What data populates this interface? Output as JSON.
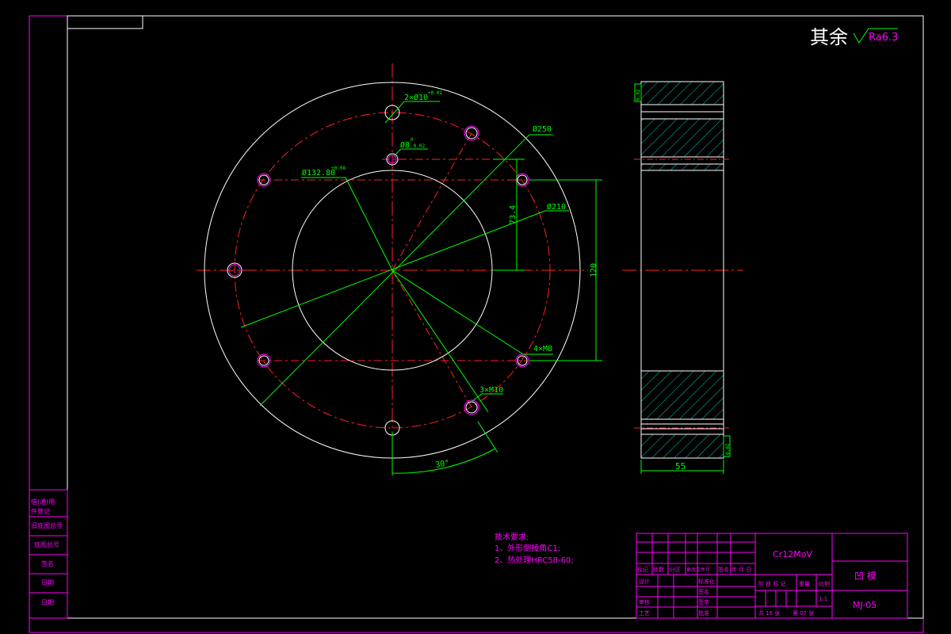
{
  "roughness": {
    "prefix": "其余",
    "value": "Ra6.3"
  },
  "dims": {
    "holes_top": "2×Ø10",
    "holes_top_tol": "+0.01",
    "d250": "Ø250",
    "d8": "Ø8",
    "d8_tol_up": "0",
    "d8_tol_low": "-0.02",
    "d13280": "Ø132.80",
    "d13280_tol": "+0.08",
    "d210": "Ø210",
    "v734": "73.4",
    "v120": "120",
    "m8": "4×M8",
    "m10": "3×M10",
    "angle": "30°",
    "width": "55",
    "tol_side_top": "0.02",
    "tol_side_bot": "0.02"
  },
  "tech": {
    "title": "技术要求:",
    "line1": "1、外形倒棱角C1;",
    "line2": "2、热处理HRC58-60;"
  },
  "left_labels": [
    "借(通)用",
    "件登记",
    "旧底图总号",
    "底图总号",
    "签名",
    "日期",
    "日期"
  ],
  "title_block": {
    "material": "Cr12MoV",
    "part_name": "凹 模",
    "drawing_no": "MJ-05",
    "header_cols": [
      "标记",
      "处数",
      "分区",
      "更改文件号",
      "签名",
      "年 月 日"
    ],
    "roles": [
      "设计",
      "审核",
      "工艺"
    ],
    "roles2": [
      "标准化",
      "批准"
    ],
    "roles2_mid": [
      "签名",
      "签字"
    ],
    "stage_label": "阶 段 标 记",
    "weight_label": "重量",
    "scale_label": "比例",
    "scale_value": "1:1",
    "sheets": "共 16 张",
    "sheet_no": "第 07 张"
  }
}
